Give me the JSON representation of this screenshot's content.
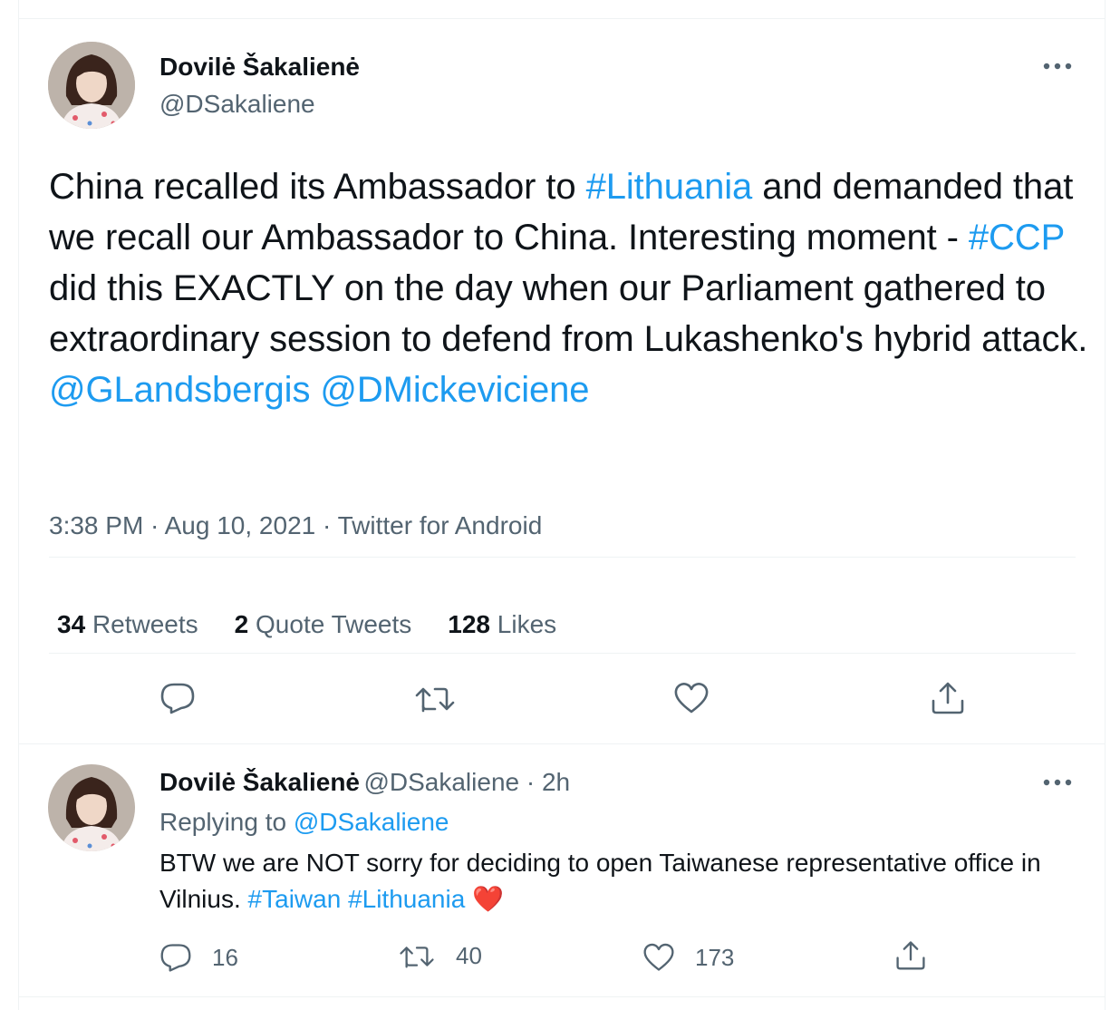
{
  "main_tweet": {
    "author_name": "Dovilė Šakalienė",
    "author_handle": "@DSakaliene",
    "text_parts": [
      "China recalled its Ambassador to ",
      "#Lithuania",
      " and demanded that we recall our Ambassador to China. Interesting moment - ",
      "#CCP",
      " did this EXACTLY on the day when our Parliament gathered to extraordinary session to defend from Lukashenko's hybrid attack. ",
      "@GLandsbergis",
      " ",
      "@DMickeviciene"
    ],
    "time": "3:38 PM",
    "date": "Aug 10, 2021",
    "source": "Twitter for Android",
    "retweets_count": "34",
    "retweets_label": "Retweets",
    "quotes_count": "2",
    "quotes_label": "Quote Tweets",
    "likes_count": "128",
    "likes_label": "Likes"
  },
  "reply_tweet": {
    "author_name": "Dovilė Šakalienė",
    "author_handle": "@DSakaliene",
    "age": "2h",
    "replying_to_label": "Replying to",
    "replying_to_handle": "@DSakaliene",
    "text_plain": "BTW we are NOT sorry for deciding to open Taiwanese representative office in Vilnius. ",
    "hashtag_1": "#Taiwan",
    "hashtag_2": "#Lithuania",
    "emoji": "❤️",
    "reply_count": "16",
    "retweet_count": "40",
    "like_count": "173"
  },
  "colors": {
    "link": "#1d9bf0",
    "text": "#0f1419",
    "secondary": "#536471",
    "divider": "#eff3f4",
    "heart": "#e0245e"
  },
  "icons": {
    "more": "more-icon",
    "reply": "reply-icon",
    "retweet": "retweet-icon",
    "like": "heart-icon",
    "share": "share-icon"
  }
}
